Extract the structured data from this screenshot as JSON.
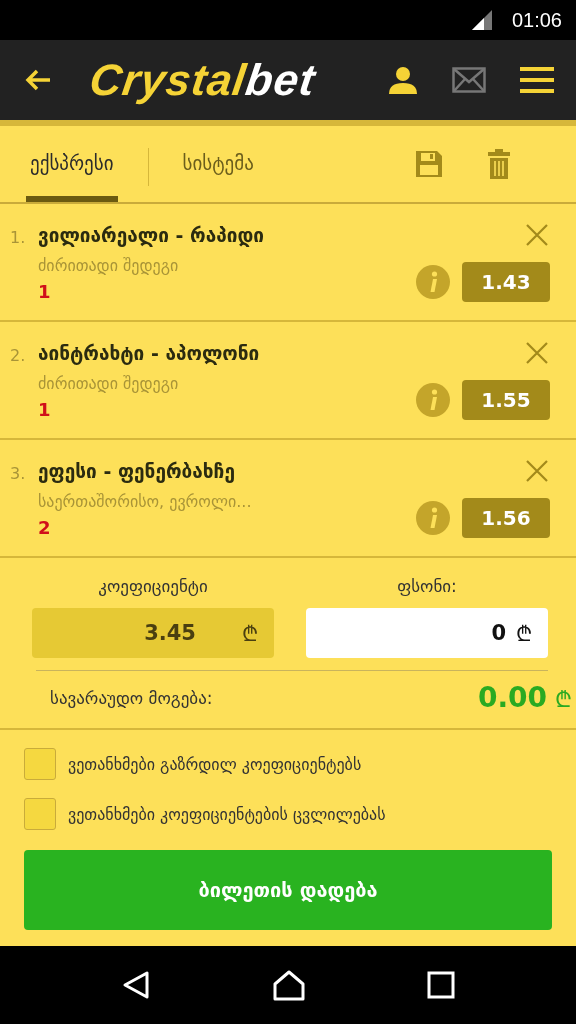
{
  "status_bar": {
    "time": "01:06"
  },
  "header": {
    "logo": {
      "part_1": "Crystal",
      "part_2": "bet"
    }
  },
  "tabs": [
    {
      "label": "ექსპრესი",
      "selected": true
    },
    {
      "label": "სისტემა",
      "selected": false
    }
  ],
  "bets": [
    {
      "number": "1.",
      "match": "ვილიარეალი - რაპიდი",
      "market": "ძირითადი შედეგი",
      "pick": "1",
      "odds": "1.43"
    },
    {
      "number": "2.",
      "match": "აინტრახტი - აპოლონი",
      "market": "ძირითადი შედეგი",
      "pick": "1",
      "odds": "1.55"
    },
    {
      "number": "3.",
      "match": "ეფესი - ფენერბახჩე",
      "market": "საერთაშორისო, ევროლი...",
      "pick": "2",
      "odds": "1.56"
    }
  ],
  "totals": {
    "coefficient_label": "კოეფიციენტი",
    "coefficient": "3.45",
    "coefficient_currency": "₾",
    "stake_label": "ფსონი:",
    "stake": "0",
    "stake_currency": "₾",
    "win_label": "სავარაუდო მოგება:",
    "win": "0.00",
    "win_currency": "₾"
  },
  "options": [
    {
      "label": "ვეთანხმები გაზრდილ კოეფიციენტებს",
      "checked": false
    },
    {
      "label": "ვეთანხმები კოეფიციენტების ცვლილებას",
      "checked": false
    }
  ],
  "place_bet_button": "ბილეთის დადება"
}
